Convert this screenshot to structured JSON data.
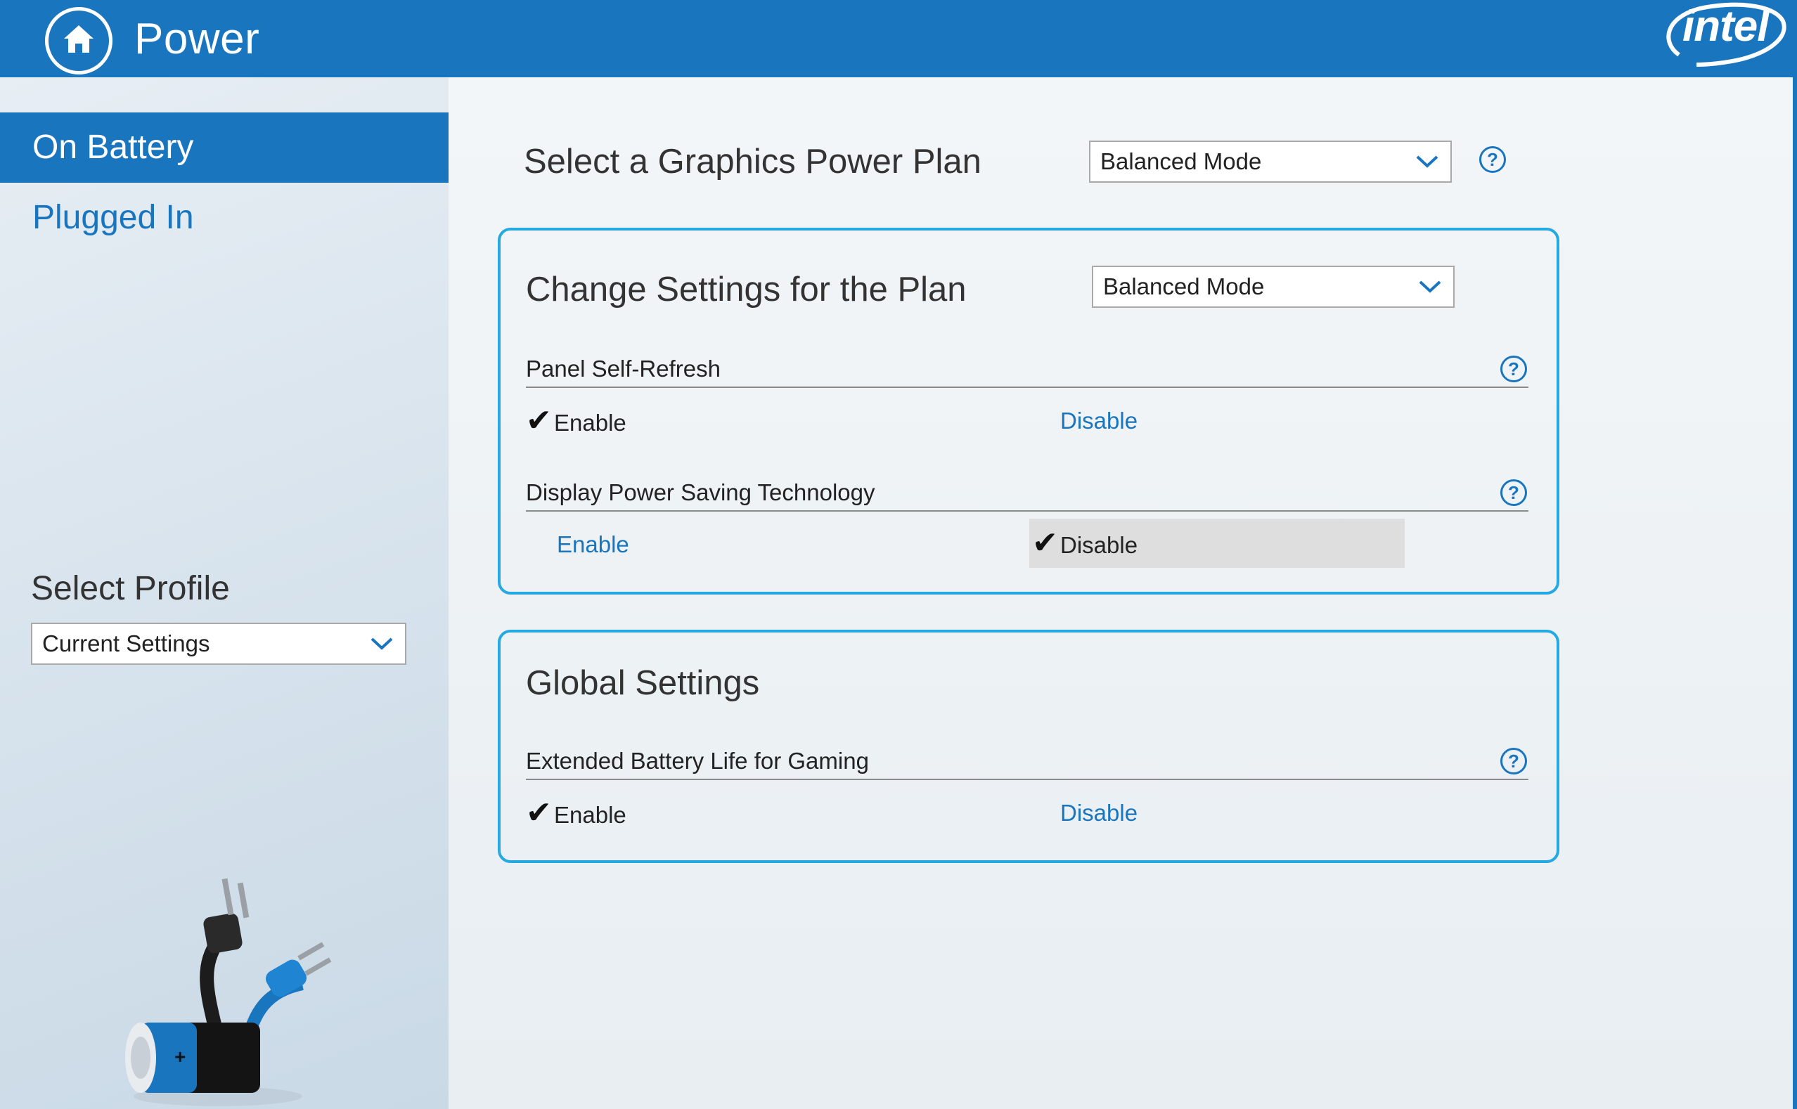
{
  "header": {
    "title": "Power",
    "logo_text": "intel",
    "home_icon": "home-icon"
  },
  "sidebar": {
    "items": [
      {
        "label": "On Battery",
        "active": true
      },
      {
        "label": "Plugged In",
        "active": false
      }
    ],
    "profile": {
      "label": "Select Profile",
      "value": "Current Settings"
    }
  },
  "main": {
    "power_plan": {
      "title": "Select a Graphics Power Plan",
      "value": "Balanced Mode"
    },
    "plan_panel": {
      "title": "Change Settings for the Plan",
      "value": "Balanced Mode",
      "settings": [
        {
          "label": "Panel Self-Refresh",
          "enable": "Enable",
          "disable": "Disable",
          "selected": "Enable"
        },
        {
          "label": "Display Power Saving Technology",
          "enable": "Enable",
          "disable": "Disable",
          "selected": "Disable"
        }
      ]
    },
    "global_panel": {
      "title": "Global Settings",
      "settings": [
        {
          "label": "Extended Battery Life for Gaming",
          "enable": "Enable",
          "disable": "Disable",
          "selected": "Enable"
        }
      ]
    },
    "help_symbol": "?",
    "check_symbol": "✔"
  },
  "colors": {
    "accent": "#1a75bf",
    "panel_border": "#26a8e0",
    "highlight": "#dedede"
  }
}
